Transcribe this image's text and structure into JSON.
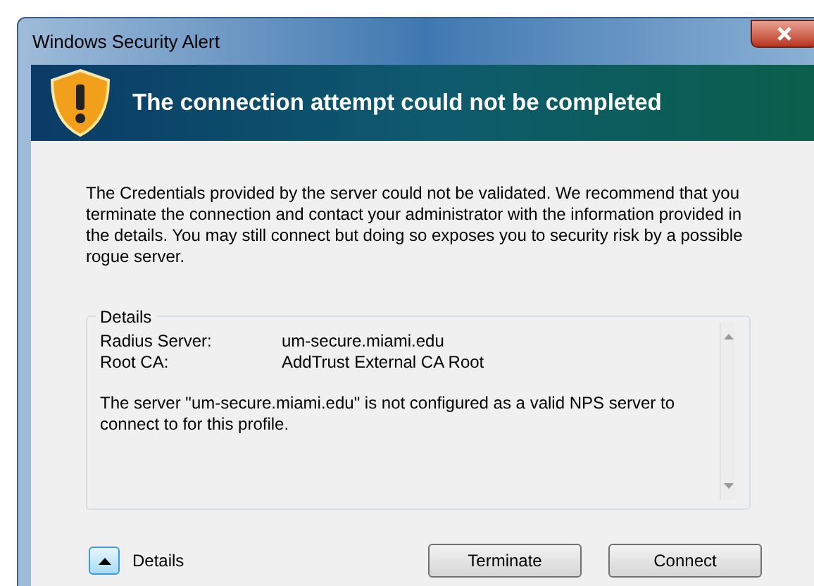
{
  "window": {
    "title": "Windows Security Alert"
  },
  "header": {
    "title": "The connection attempt could not be completed"
  },
  "message": "The Credentials provided by the server could not be validated. We recommend that you terminate the connection and contact your administrator with the information provided in the details. You may still connect but doing so exposes you to security risk by a possible rogue server.",
  "details": {
    "legend": "Details",
    "fields": [
      {
        "label": "Radius Server:",
        "value": "um-secure.miami.edu"
      },
      {
        "label": "Root CA:",
        "value": "AddTrust External CA Root"
      }
    ],
    "note": "The server \"um-secure.miami.edu\" is not configured as a valid NPS server to connect to for this profile."
  },
  "details_toggle": {
    "label": "Details",
    "expanded": true
  },
  "buttons": [
    "Terminate",
    "Connect"
  ]
}
